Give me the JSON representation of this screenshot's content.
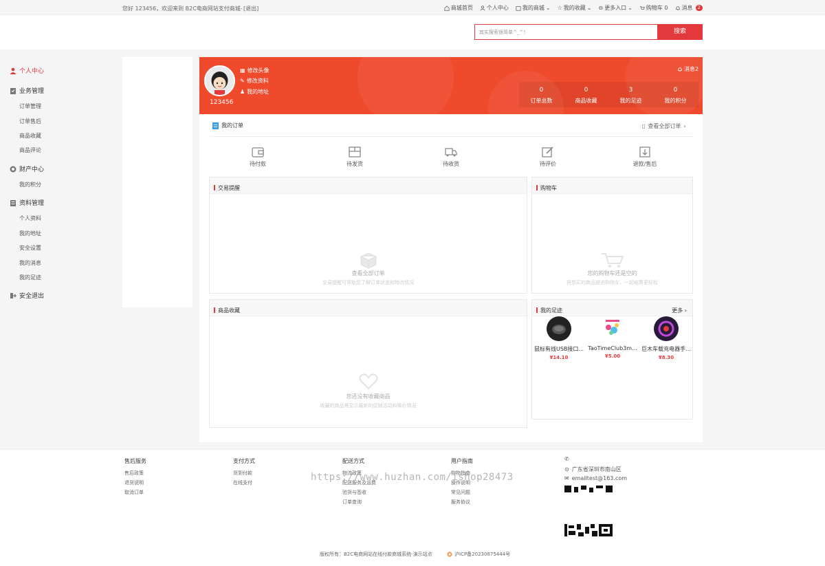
{
  "topbar": {
    "welcome": "您好 123456，欢迎来到 B2C电商网站支付商城-",
    "logout": "[退出]",
    "nav": [
      {
        "label": "商城首页",
        "icon": "home-icon"
      },
      {
        "label": "个人中心",
        "icon": "user-icon"
      },
      {
        "label": "我的商城",
        "icon": "shop-icon"
      },
      {
        "label": "我的收藏",
        "icon": "star-icon"
      },
      {
        "label": "更多入口",
        "icon": "more-icon"
      },
      {
        "label": "购物车 0",
        "icon": "cart-icon"
      },
      {
        "label": "消息",
        "icon": "bell-icon"
      }
    ],
    "message_count": "2"
  },
  "search": {
    "placeholder": "其实搜索很简单^_^！",
    "button": "搜索"
  },
  "sidebar": {
    "groups": [
      {
        "label": "个人中心",
        "icon": "user-icon",
        "active": true
      },
      {
        "label": "业务管理",
        "icon": "clipboard-icon"
      },
      {
        "label": "财产中心",
        "icon": "coin-icon"
      },
      {
        "label": "资料管理",
        "icon": "profile-icon"
      },
      {
        "label": "安全退出",
        "icon": "exit-icon"
      }
    ],
    "business": [
      "订单管理",
      "订单售后",
      "商品收藏",
      "商品评论"
    ],
    "assets": [
      "我的积分"
    ],
    "profile": [
      "个人资料",
      "我的地址",
      "安全设置",
      "我的消息",
      "我的足迹"
    ]
  },
  "banner": {
    "username": "123456",
    "links": [
      "修改头像",
      "修改资料",
      "我的地址"
    ],
    "message": "消息2",
    "stats": [
      {
        "value": "0",
        "label": "订单总数"
      },
      {
        "value": "0",
        "label": "商品收藏"
      },
      {
        "value": "3",
        "label": "我的足迹"
      },
      {
        "value": "0",
        "label": "我的积分"
      }
    ]
  },
  "orders": {
    "title": "我的订单",
    "view_all": "查看全部订单",
    "statuses": [
      "待付款",
      "待发货",
      "待收货",
      "待评价",
      "退款/售后"
    ]
  },
  "trade": {
    "title": "交易提醒",
    "empty_title": "查看全部订单",
    "empty_sub": "交易提醒可帮助您了解订单状态和物流情况"
  },
  "cart": {
    "title": "购物车",
    "empty_title": "您的购物车还是空的",
    "empty_sub": "将想买的商品放进购物车，一起结算更轻松"
  },
  "favorites": {
    "title": "商品收藏",
    "empty_title": "您还没有收藏商品",
    "empty_sub": "收藏的商品将显示最新的促销活动和降价情况"
  },
  "footprint": {
    "title": "我的足迹",
    "more": "更多",
    "items": [
      {
        "name": "鼠标有线USB接口...",
        "price": "¥14.10"
      },
      {
        "name": "TaoTimeClub3m...",
        "price": "¥5.00"
      },
      {
        "name": "巨木车载充电器手...",
        "price": "¥8.30"
      }
    ]
  },
  "footer": {
    "columns": [
      {
        "title": "售后服务",
        "items": [
          "售后政策",
          "退货说明",
          "取消订单"
        ]
      },
      {
        "title": "支付方式",
        "items": [
          "货到付款",
          "在线支付"
        ]
      },
      {
        "title": "配送方式",
        "items": [
          "物流政策",
          "配送服务及运费",
          "验货与签收",
          "订单查询"
        ]
      },
      {
        "title": "用户指南",
        "items": [
          "购物指南",
          "操作说明",
          "常见问题",
          "服务协议"
        ]
      }
    ],
    "address": "广东省深圳市南山区",
    "email": "emailtest@163.com",
    "copyright": "版权所有：B2C电商网站在线付款商城系统-演示站点",
    "icp": "沪ICP备20230875444号",
    "watermark": "https://www.huzhan.com/ishop28473"
  },
  "colors": {
    "accent": "#e4393c",
    "banner": "#f04a2c"
  }
}
